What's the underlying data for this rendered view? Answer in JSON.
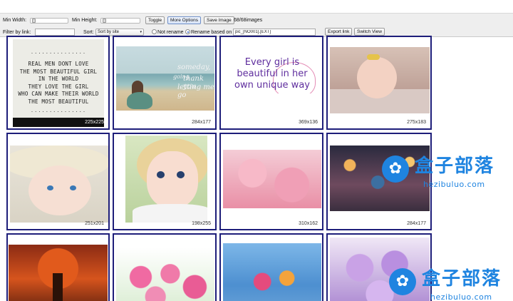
{
  "toolbar": {
    "min_width_label": "Min Width:",
    "min_height_label": "Min Height:",
    "toggle_label": "Toggle",
    "more_options_label": "More Options",
    "save_image_label": "Save Image",
    "image_count": "68/68images",
    "filter_label": "Filter by link:",
    "filter_value": "",
    "sort_label": "Sort:",
    "sort_selected": "Sort by site",
    "not_rename_label": "Not rename",
    "rename_label": "Rename based on",
    "rename_pattern": "pic_[NO001].[EXT]",
    "export_link_label": "Export link",
    "switch_view_label": "Switch View"
  },
  "quote_text": {
    "dots_top": "...............",
    "lines": [
      "REAL MEN DONT LOVE",
      "THE MOST BEAUTIFUL GIRL",
      "IN THE WORLD",
      "THEY LOVE THE GIRL",
      "WHO CAN MAKE THEIR WORLD",
      "THE MOST BEAUTIFUL"
    ],
    "dots_bottom": "..............."
  },
  "beach_text": {
    "w1": "someday,",
    "w2": "going",
    "w3": "thank you",
    "w4": "letting me go"
  },
  "everygirl_text": {
    "l1": "Every girl is",
    "l2": "beautiful in her",
    "l3": "own unique way"
  },
  "tiles": [
    {
      "dims": "225x225"
    },
    {
      "dims": "284x177"
    },
    {
      "dims": "369x136"
    },
    {
      "dims": "275x183"
    },
    {
      "dims": "251x201"
    },
    {
      "dims": "198x255"
    },
    {
      "dims": "310x162"
    },
    {
      "dims": "284x177"
    },
    {
      "dims": ""
    },
    {
      "dims": ""
    },
    {
      "dims": ""
    },
    {
      "dims": ""
    }
  ],
  "watermark": {
    "glyph": "✿",
    "cn": "盒子部落",
    "url": "hezibuluo.com"
  },
  "icons": {
    "knob": "slider-knob",
    "caret": "chevron-down-icon",
    "save": "save-icon"
  },
  "colors": {
    "tile_border": "#1e1e7a",
    "watermark": "#1f84e0",
    "toolbar_bg": "#eeeeee"
  }
}
